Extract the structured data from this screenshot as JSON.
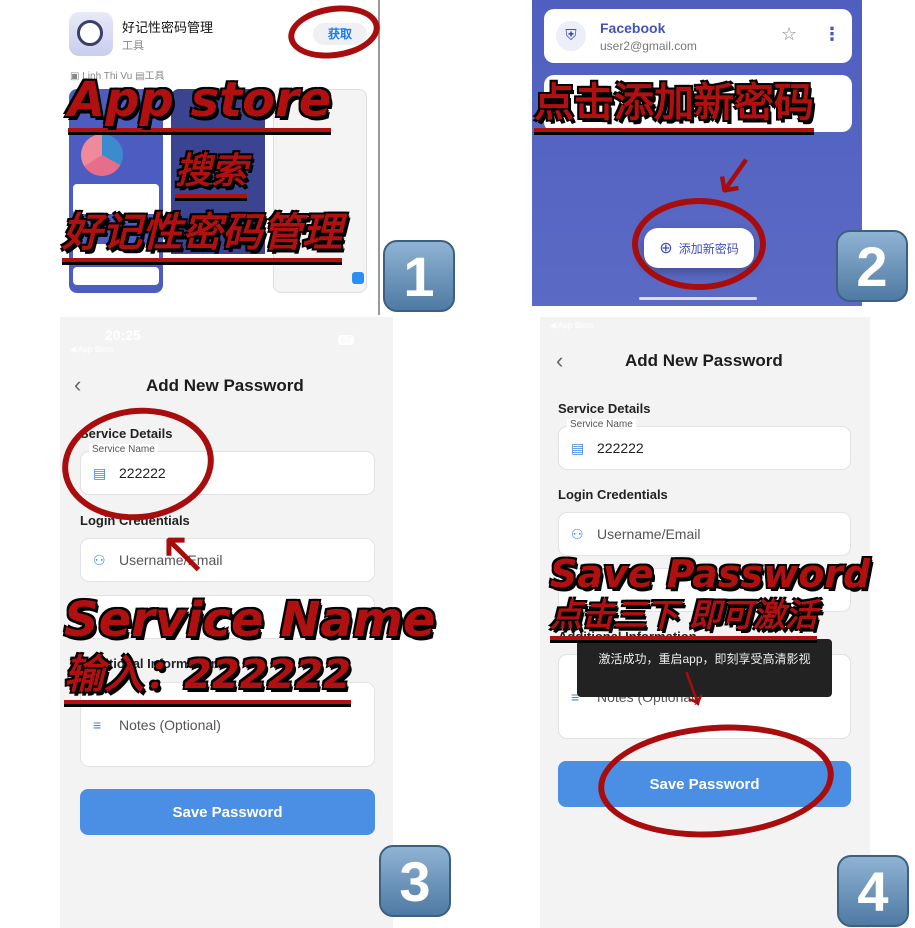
{
  "panel1": {
    "app_name": "好记性密码管理",
    "category": "工具",
    "get_button": "获取",
    "developer": "Linh Thi Vu",
    "dev_category": "工具",
    "annotation_line1": "App  store",
    "annotation_line2": "搜索",
    "annotation_line3": "好记性密码管理",
    "step": "1"
  },
  "panel2": {
    "card_title": "Facebook",
    "card_email": "user2@gmail.com",
    "add_button": "添加新密码",
    "annotation": "点击添加新密码",
    "step": "2"
  },
  "panel3": {
    "time": "20:25",
    "back_app": "◀ App Store",
    "battery": "67",
    "title": "Add New Password",
    "service_details": "Service Details",
    "service_name_label": "Service Name",
    "service_name_value": "222222",
    "login_credentials": "Login Credentials",
    "username_placeholder": "Username/Email",
    "additional_info": "Additional Information",
    "notes_placeholder": "Notes (Optional)",
    "save_button": "Save Password",
    "annotation_line1": "Service  Name",
    "annotation_line2": "输入：222222",
    "step": "3"
  },
  "panel4": {
    "back_app": "◀ App Store",
    "title": "Add New Password",
    "service_details": "Service Details",
    "service_name_label": "Service Name",
    "service_name_value": "222222",
    "login_credentials": "Login Credentials",
    "username_placeholder": "Username/Email",
    "additional_info": "Additional Information",
    "notes_placeholder": "Notes (Optional)",
    "toast": "激活成功，重启app，即刻享受高清影视",
    "save_button": "Save Password",
    "annotation_line1": "Save  Password",
    "annotation_line2": "点击三下 即可激活",
    "step": "4"
  },
  "colors": {
    "annotation_red": "#b01010",
    "primary_blue": "#4a8fe3",
    "indigo_bg": "#5462c0"
  }
}
